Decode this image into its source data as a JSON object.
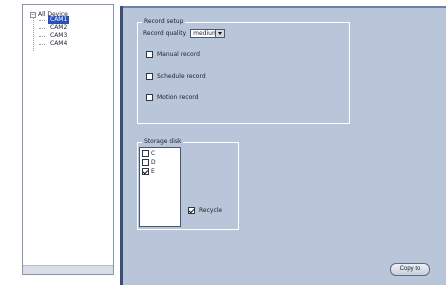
{
  "tree": {
    "root_label": "All Device",
    "expander_symbol": "−",
    "items": [
      {
        "label": "CAM1",
        "selected": true
      },
      {
        "label": "CAM2"
      },
      {
        "label": "CAM3"
      },
      {
        "label": "CAM4"
      }
    ]
  },
  "record_setup": {
    "title": "Record setup",
    "quality_label": "Record quality",
    "quality_value": "medium",
    "manual_record": {
      "label": "Manual record",
      "checked": false
    },
    "schedule_record": {
      "label": "Schedule record",
      "checked": false
    },
    "motion_record": {
      "label": "Motion record",
      "checked": false
    }
  },
  "storage": {
    "title": "Storage disk",
    "disks": [
      {
        "label": "C",
        "checked": false
      },
      {
        "label": "D",
        "checked": false
      },
      {
        "label": "E",
        "checked": true
      }
    ],
    "recycle": {
      "label": "Recycle",
      "checked": true
    }
  },
  "buttons": {
    "copy_to": "Copy to"
  },
  "colors": {
    "panel_background": "#b9c6d9",
    "selection_highlight": "#2a4fb8",
    "panel_border_dark": "#3b4e7a"
  }
}
